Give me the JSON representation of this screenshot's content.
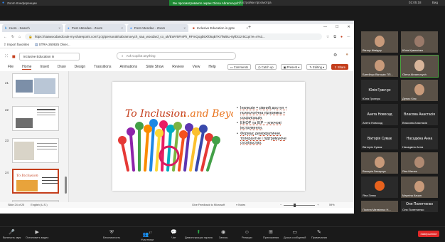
{
  "zoom_window": {
    "title": "Zoom Конференции",
    "share_banner": "Вы просматриваете экран Olena Abramovych",
    "view_options": "Настройки просмотра",
    "right_status": "01:05:18",
    "view_label": "Вид"
  },
  "browser": {
    "tabs": [
      {
        "label": "zoom - Search",
        "icon": "bing-icon"
      },
      {
        "label": "Post Attendee - Zoom",
        "icon": "zoom-icon"
      },
      {
        "label": "Post Attendee - Zoom",
        "icon": "zoom-icon"
      },
      {
        "label": "Inclusive Education in.pptx",
        "icon": "powerpoint-icon"
      }
    ],
    "url": "https://saawoodandcouk-my.sharepoint.com/:p:/g/personal/oabramovych_saa_woodard_co_uk/EWV5FIsPh_RFmQogb5Xf05qBTK7fwlBU-8yfDtzzr5Cq4?e=4%3...",
    "bookmarks": [
      "Import favorites",
      "STRA-260925 Olver..."
    ]
  },
  "ppt": {
    "filename": "Inclusive Education in",
    "copilot_placeholder": "Ask Copilot anything",
    "ribbon_tabs": [
      "File",
      "Home",
      "Insert",
      "Draw",
      "Design",
      "Transitions",
      "Animations",
      "Slide Show",
      "Review",
      "View",
      "Help"
    ],
    "active_ribbon": "Home",
    "buttons": {
      "comments": "Comments",
      "catchup": "Catch up",
      "present": "Present",
      "editing": "Editing",
      "share": "Share"
    },
    "thumbnails": [
      {
        "num": "21"
      },
      {
        "num": "22"
      },
      {
        "num": "23"
      },
      {
        "num": "24"
      },
      {
        "num": "25"
      }
    ],
    "selected_thumbnail": "24",
    "slide": {
      "title_part1": "To Inclusion",
      "title_part2": "...and Beyond!",
      "bullets": [
        "Інклюзія = рівний доступ + психологічна підтримка + соціалізація.",
        "ЕНОР та ІЕР – ключові інструменти.",
        "Формує демократичне, толерантне і підтримуюче суспільство."
      ]
    },
    "status": {
      "slide_info": "Slide 24 of 25",
      "language": "English (U.S.)",
      "feedback": "Give Feedback to Microsoft",
      "notes": "Notes",
      "zoom": "59%"
    }
  },
  "participants": [
    {
      "name": "Віктор Шмідер"
    },
    {
      "name": "Юлія Куманічка"
    },
    {
      "name": "Батейчук Вікторія ПП..."
    },
    {
      "name": "Olena Abramovych"
    },
    {
      "name": "Юлія Гринчук"
    },
    {
      "name": "Денис Кінс"
    },
    {
      "name": "Анета Новосад"
    },
    {
      "name": "Власова Анастасія"
    },
    {
      "name": "Вікторія Сумак"
    },
    {
      "name": "Насадкіна Анна"
    },
    {
      "name": "Валерія Захарчук"
    },
    {
      "name": "Яна Матюк"
    },
    {
      "name": "Яна Зілюк"
    },
    {
      "name": "Мартіна Качан"
    },
    {
      "name": "Поліна Матвієнко Н..."
    },
    {
      "name": "Оля Полетченко"
    }
  ],
  "zoom_controls": [
    {
      "label": "Включить звук",
      "icon": "mic-muted-icon"
    },
    {
      "label": "Остановить видео",
      "icon": "camera-icon"
    },
    {
      "label": "Безопасность",
      "icon": "shield-icon"
    },
    {
      "label": "Участники",
      "icon": "participants-icon",
      "count": "17"
    },
    {
      "label": "Чат",
      "icon": "chat-icon"
    },
    {
      "label": "Демонстрация экрана",
      "icon": "share-screen-icon"
    },
    {
      "label": "Запись",
      "icon": "record-icon"
    },
    {
      "label": "Реакции",
      "icon": "reaction-icon"
    },
    {
      "label": "Приложения",
      "icon": "apps-icon"
    },
    {
      "label": "Доска сообщений",
      "icon": "whiteboard-icon"
    },
    {
      "label": "Примечания",
      "icon": "notes-icon"
    }
  ],
  "end_button": "Завершение"
}
